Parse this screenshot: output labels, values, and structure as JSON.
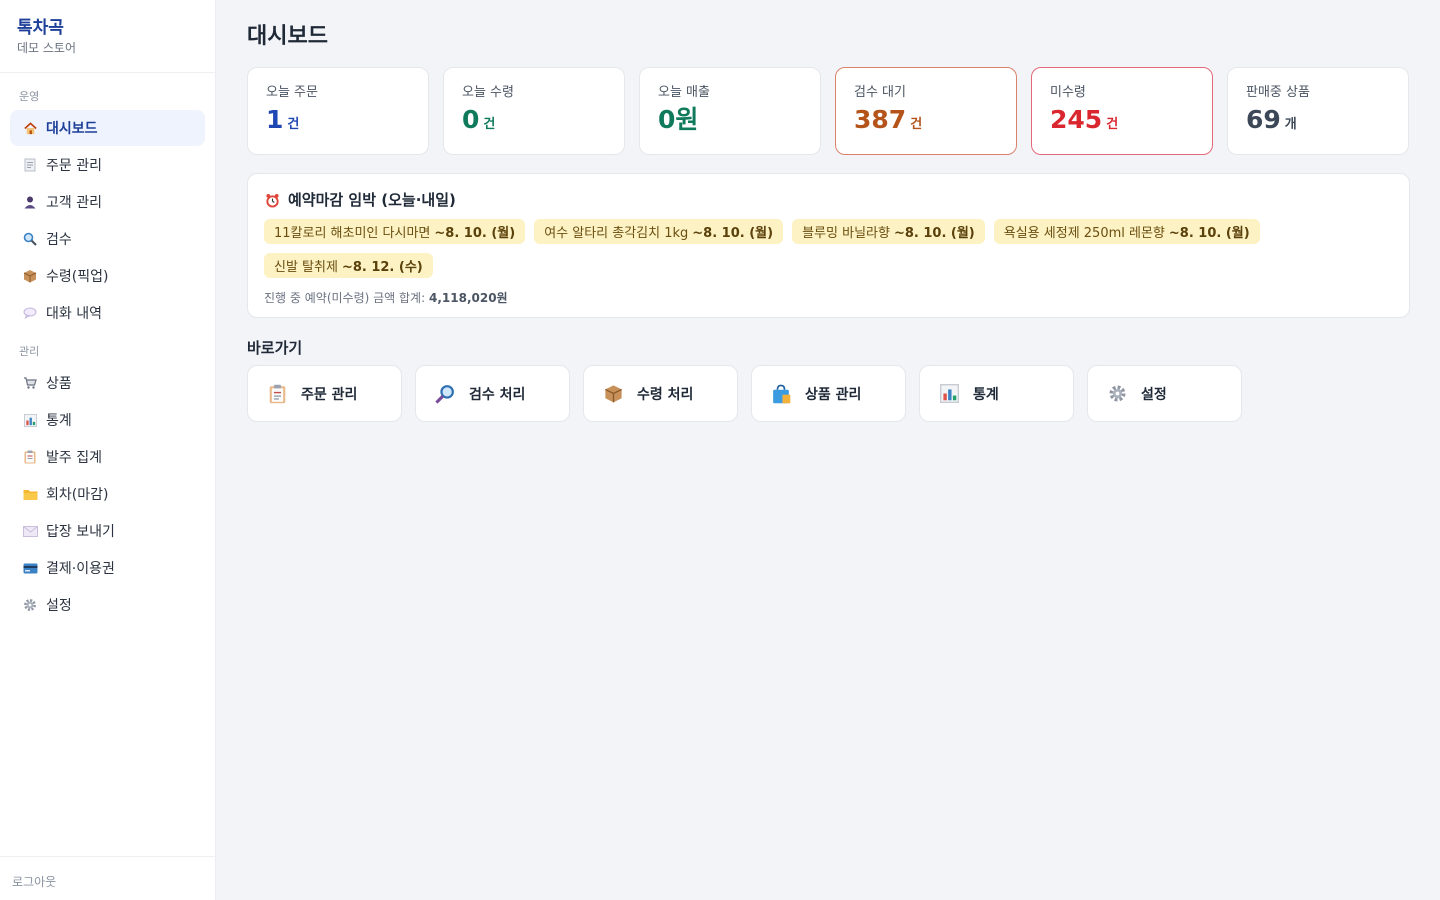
{
  "brand": {
    "name": "톡차곡",
    "sub": "데모 스토어"
  },
  "sidebar": {
    "section_ops": "운영",
    "section_admin": "관리",
    "ops_items": [
      {
        "label": "대시보드",
        "icon": "house-icon"
      },
      {
        "label": "주문 관리",
        "icon": "receipt-icon"
      },
      {
        "label": "고객 관리",
        "icon": "person-icon"
      },
      {
        "label": "검수",
        "icon": "magnifier-icon"
      },
      {
        "label": "수령(픽업)",
        "icon": "package-icon"
      },
      {
        "label": "대화 내역",
        "icon": "speech-bubble-icon"
      }
    ],
    "admin_items": [
      {
        "label": "상품",
        "icon": "cart-icon"
      },
      {
        "label": "통계",
        "icon": "bar-chart-icon"
      },
      {
        "label": "발주 집계",
        "icon": "clipboard-icon"
      },
      {
        "label": "회차(마감)",
        "icon": "folder-icon"
      },
      {
        "label": "답장 보내기",
        "icon": "envelope-icon"
      },
      {
        "label": "결제·이용권",
        "icon": "credit-card-icon"
      },
      {
        "label": "설정",
        "icon": "gear-icon"
      }
    ],
    "logout": "로그아웃"
  },
  "page": {
    "title": "대시보드"
  },
  "stats": [
    {
      "label": "오늘 주문",
      "value": "1",
      "unit": "건",
      "color": "#1f47b3"
    },
    {
      "label": "오늘 수령",
      "value": "0",
      "unit": "건",
      "color": "#0f7a5c"
    },
    {
      "label": "오늘 매출",
      "value": "0원",
      "unit": "",
      "color": "#0f7a5c"
    },
    {
      "label": "검수 대기",
      "value": "387",
      "unit": "건",
      "color": "#b4541a"
    },
    {
      "label": "미수령",
      "value": "245",
      "unit": "건",
      "color": "#d9262f"
    },
    {
      "label": "판매중 상품",
      "value": "69",
      "unit": "개",
      "color": "#3c4857"
    }
  ],
  "deadline": {
    "title": "예약마감 임박 (오늘·내일)",
    "tags": [
      {
        "name": "11칼로리 해초미인 다시마면",
        "date": "~8. 10. (월)"
      },
      {
        "name": "여수 알타리 총각김치 1kg",
        "date": "~8. 10. (월)"
      },
      {
        "name": "블루밍 바닐라향",
        "date": "~8. 10. (월)"
      },
      {
        "name": "욕실용 세정제 250ml 레몬향",
        "date": "~8. 10. (월)"
      },
      {
        "name": "신발 탈취제",
        "date": "~8. 12. (수)"
      }
    ],
    "sum_label": "진행 중 예약(미수령) 금액 합계:",
    "sum_value": "4,118,020원"
  },
  "shortcuts": {
    "title": "바로가기",
    "items": [
      {
        "label": "주문 관리",
        "icon": "clipboard-icon"
      },
      {
        "label": "검수 처리",
        "icon": "magnifier-icon"
      },
      {
        "label": "수령 처리",
        "icon": "package-icon"
      },
      {
        "label": "상품 관리",
        "icon": "shopping-bag-icon"
      },
      {
        "label": "통계",
        "icon": "bar-chart-icon"
      },
      {
        "label": "설정",
        "icon": "gear-icon"
      }
    ]
  },
  "colors": {
    "accent": "#1d3f9a",
    "active_bg": "#eef3fd",
    "tag_bg": "#fdf2c3"
  }
}
